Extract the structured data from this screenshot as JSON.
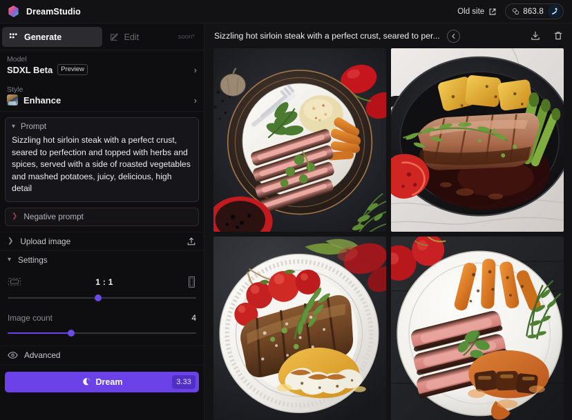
{
  "topbar": {
    "brand": "DreamStudio",
    "logo_icon": "hexagon-gradient-logo",
    "old_site_label": "Old site",
    "old_site_icon": "external-link-icon",
    "credits_icon": "coin-icon",
    "credits_amount": "863.8",
    "avatar_icon": "user-avatar-icon"
  },
  "sidebar": {
    "tabs": [
      {
        "label": "Generate",
        "icon": "grid-squares-icon",
        "active": true,
        "badge": ""
      },
      {
        "label": "Edit",
        "icon": "pencil-square-icon",
        "active": false,
        "badge": "soon*"
      }
    ],
    "model": {
      "group_label": "Model",
      "value": "SDXL Beta",
      "badge": "Preview",
      "chevron_icon": "chevron-right-icon"
    },
    "style": {
      "group_label": "Style",
      "value": "Enhance",
      "thumb_icon": "style-thumbnail-icon",
      "chevron_icon": "chevron-right-icon"
    },
    "prompt": {
      "label": "Prompt",
      "chevron_icon": "chevron-down-icon",
      "value": "Sizzling hot sirloin steak with a perfect crust, seared to perfection and topped with herbs and spices, served with a side of roasted vegetables and mashed potatoes, juicy, delicious, high detail"
    },
    "negative_prompt": {
      "label": "Negative prompt",
      "chevron_icon": "chevron-right-icon",
      "value": ""
    },
    "upload_image": {
      "label": "Upload image",
      "chevron_icon": "chevron-right-icon",
      "upload_icon": "upload-arrow-icon"
    },
    "settings": {
      "label": "Settings",
      "chevron_icon": "chevron-down-icon",
      "aspect_ratio": {
        "value": "1 : 1",
        "left_icon": "landscape-frame-icon",
        "right_icon": "portrait-phone-icon",
        "slider_percent": 48
      },
      "image_count": {
        "label": "Image count",
        "value": "4",
        "slider_percent": 33
      }
    },
    "advanced": {
      "label": "Advanced",
      "icon": "eye-icon"
    },
    "dream_button": {
      "label": "Dream",
      "icon": "moon-icon",
      "cost": "3.33",
      "accent": "#6b42e8"
    }
  },
  "main": {
    "title": "Sizzling hot sirloin steak with a perfect crust, seared to per...",
    "back_icon": "circle-arrow-left-icon",
    "actions": [
      {
        "name": "download-button",
        "icon": "download-icon"
      },
      {
        "name": "delete-button",
        "icon": "trash-icon"
      }
    ],
    "results": [
      {
        "name": "result-image-1",
        "description": "Sliced sirloin steak on white plate with dark rim, mashed potatoes, roasted carrots, fresh herbs, tomatoes and garlic on dark slate surface",
        "palette": {
          "bg": "#26282c",
          "plate": "#f2f0ec",
          "rim": "#3b332e",
          "steak_crust": "#3a211a",
          "steak_center": "#e0918f",
          "veg": "#d8762c",
          "herb": "#4e7a34",
          "tomato": "#c41f24",
          "mash": "#e8dcae"
        }
      },
      {
        "name": "result-image-2",
        "description": "Cast iron skillet on white marble with sliced steak, roasted potato chunks, asparagus spears, rosemary sprig and red pepper in pan sauce",
        "palette": {
          "bg": "#ded9d4",
          "pan": "#151517",
          "steak_crust": "#5a2f1e",
          "steak_center": "#c9937a",
          "veg": "#e8b63a",
          "herb": "#6f9c3f",
          "tomato": "#cf2b26",
          "sauce": "#2a0f0c"
        }
      },
      {
        "name": "result-image-3",
        "description": "Ornate embossed white plate with grilled steak, cherry tomatoes on the vine, rosemary sprig and sliced potatoes in golden sauce on dark background",
        "palette": {
          "bg": "#2a2b2f",
          "plate": "#f4f3ef",
          "steak_crust": "#6a4226",
          "steak_center": "#a9703f",
          "veg": "#e7b03c",
          "herb": "#4f7c33",
          "tomato": "#cb2226",
          "sauce": "#e0ab3c"
        }
      },
      {
        "name": "result-image-4",
        "description": "White plate with medium-rare sliced steak, roasted carrot batons, thyme sprigs and braised cubes in orange sauce with cherry tomatoes on dark wood",
        "palette": {
          "bg": "#24262a",
          "plate": "#f3f2ee",
          "steak_crust": "#3d2218",
          "steak_center": "#d98f86",
          "veg": "#e07b2a",
          "herb": "#3f6b2c",
          "tomato": "#c4201f",
          "sauce": "#c96a2b"
        }
      }
    ]
  }
}
